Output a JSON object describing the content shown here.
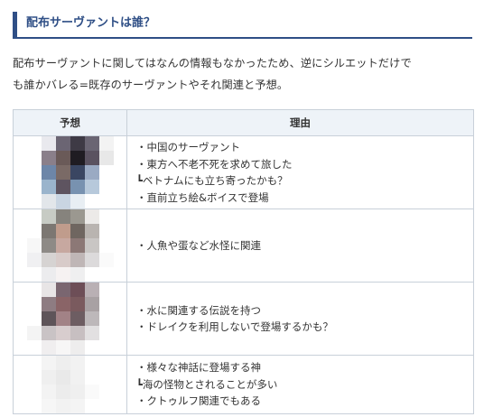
{
  "heading": "配布サーヴァントは誰？",
  "intro": {
    "line1": "配布サーヴァントに関してはなんの情報もなかったため、逆にシルエットだけで",
    "line2": "も誰かバレる=既存のサーヴァントやそれ関連と予想。"
  },
  "table": {
    "headers": [
      "予想",
      "理由"
    ],
    "rows": [
      {
        "image_label": "pixelated-servant-portrait-1",
        "mosaic": [
          [
            "#ffffff",
            "#e9e9ee",
            "#6b6573",
            "#3e3a45",
            "#6a6573",
            "#f3f3f3"
          ],
          [
            "#ffffff",
            "#8a7f8a",
            "#6a5a58",
            "#1f1c22",
            "#5a5260",
            "#e8e8e8"
          ],
          [
            "#ffffff",
            "#6d86a8",
            "#7a6a66",
            "#3a4662",
            "#9aaac3",
            "#ffffff"
          ],
          [
            "#ffffff",
            "#9ab4cc",
            "#5e5460",
            "#7892b0",
            "#b7c9db",
            "#ffffff"
          ],
          [
            "#ffffff",
            "#e2e6ea",
            "#c9d5e2",
            "#e8eef3",
            "#ffffff",
            "#ffffff"
          ]
        ],
        "reasons": [
          "・中国のサーヴァント",
          "・東方へ不老不死を求めて旅した",
          "┗ベトナムにも立ち寄ったかも？",
          "・直前立ち絵&ボイスで登場"
        ]
      },
      {
        "image_label": "pixelated-servant-portrait-2",
        "mosaic": [
          [
            "#ffffff",
            "#c7cbc4",
            "#86837d",
            "#9b9890",
            "#eceae8",
            "#ffffff"
          ],
          [
            "#ffffff",
            "#7c7772",
            "#c09c8c",
            "#6f6660",
            "#b9b4b0",
            "#ffffff"
          ],
          [
            "#f7f7f7",
            "#8e8a86",
            "#c7a8a0",
            "#8c7876",
            "#c9c6c4",
            "#ffffff"
          ],
          [
            "#f0f0f2",
            "#d6d3d2",
            "#d8cbc9",
            "#bfb6b6",
            "#dcdadb",
            "#fafafa"
          ],
          [
            "#ffffff",
            "#ececee",
            "#f6f2f2",
            "#efeff0",
            "#ffffff",
            "#ffffff"
          ]
        ],
        "reasons": [
          "・人魚や蛋など水怪に関連"
        ]
      },
      {
        "image_label": "pixelated-servant-portrait-3",
        "mosaic": [
          [
            "#ffffff",
            "#e8e5e6",
            "#7a6670",
            "#6d4e57",
            "#b9b0b4",
            "#ffffff"
          ],
          [
            "#ffffff",
            "#8e7c82",
            "#8a6467",
            "#7a5a5e",
            "#a8a1a3",
            "#ffffff"
          ],
          [
            "#ffffff",
            "#5e5459",
            "#a28286",
            "#6d5d62",
            "#bdb8ba",
            "#ffffff"
          ],
          [
            "#f4f4f4",
            "#c9c3c5",
            "#d8cdce",
            "#c7bfc1",
            "#e2e0e1",
            "#ffffff"
          ],
          [
            "#ffffff",
            "#f0eeef",
            "#f7f6f6",
            "#eeeded",
            "#ffffff",
            "#ffffff"
          ]
        ],
        "reasons": [
          "・水に関連する伝説を持つ",
          "・ドレイクを利用しないで登場するかも？"
        ]
      },
      {
        "image_label": "pixelated-servant-portrait-4",
        "mosaic": [
          [
            "#ffffff",
            "#f4f4f4",
            "#eeeeee",
            "#f2f2f2",
            "#ffffff",
            "#ffffff"
          ],
          [
            "#ffffff",
            "#efefef",
            "#e9e9e9",
            "#f1f1f1",
            "#ffffff",
            "#ffffff"
          ],
          [
            "#ffffff",
            "#f3f3f3",
            "#ececec",
            "#efefef",
            "#fafafa",
            "#ffffff"
          ],
          [
            "#ffffff",
            "#f6f6f6",
            "#f2f2f2",
            "#f4f4f4",
            "#ffffff",
            "#ffffff"
          ]
        ],
        "reasons": [
          "・様々な神話に登場する神",
          "┗海の怪物とされることが多い",
          "・クトゥルフ関連でもある"
        ]
      }
    ]
  }
}
